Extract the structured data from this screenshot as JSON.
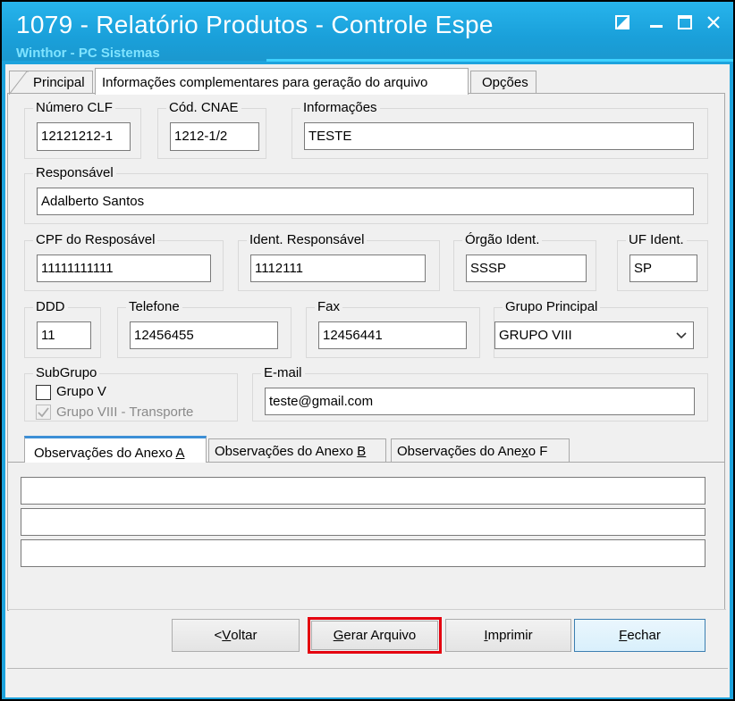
{
  "window": {
    "title": "1079 - Relatório Produtos - Controle Espe",
    "subtitle": "Winthor - PC Sistemas"
  },
  "tabs": [
    {
      "label": "Principal"
    },
    {
      "label": "Informações complementares para geração do arquivo"
    },
    {
      "label": "Opções"
    }
  ],
  "fields": {
    "numero_clf": {
      "label": "Número CLF",
      "value": "12121212-1"
    },
    "cod_cnae": {
      "label": "Cód. CNAE",
      "value": "1212-1/2"
    },
    "informacoes": {
      "label": "Informações",
      "value": "TESTE"
    },
    "responsavel": {
      "label": "Responsável",
      "value": "Adalberto Santos"
    },
    "cpf": {
      "label": "CPF do Resposável",
      "value": "11111111111"
    },
    "ident_responsavel": {
      "label": "Ident. Responsável",
      "value": "1112111"
    },
    "orgao_ident": {
      "label": "Órgão Ident.",
      "value": "SSSP"
    },
    "uf_ident": {
      "label": "UF Ident.",
      "value": "SP"
    },
    "ddd": {
      "label": "DDD",
      "value": "11"
    },
    "telefone": {
      "label": "Telefone",
      "value": "12456455"
    },
    "fax": {
      "label": "Fax",
      "value": "12456441"
    },
    "grupo_principal": {
      "label": "Grupo Principal",
      "value": "GRUPO VIII"
    },
    "email": {
      "label": "E-mail",
      "value": "teste@gmail.com"
    }
  },
  "subgrupo": {
    "label": "SubGrupo",
    "options": [
      {
        "label": "Grupo V",
        "checked": false,
        "enabled": true
      },
      {
        "label": "Grupo VIII - Transporte",
        "checked": true,
        "enabled": false
      }
    ]
  },
  "obs_tabs": {
    "a": {
      "prefix": "Observações do Anexo ",
      "key": "A"
    },
    "b": {
      "prefix": "Observações do Anexo ",
      "key": "B"
    },
    "f": {
      "prefix1": "Observações do Ane",
      "key": "x",
      "suffix": "o F"
    }
  },
  "buttons": {
    "voltar": {
      "prefix": "< ",
      "key": "V",
      "rest": "oltar"
    },
    "gerar": {
      "key": "G",
      "rest": "erar Arquivo"
    },
    "imprimir": {
      "key": "I",
      "rest": "mprimir"
    },
    "fechar": {
      "key": "F",
      "rest": "echar"
    }
  },
  "colors": {
    "titlebar": "#1da3dd",
    "highlight": "#e4000f",
    "active_tab_accent": "#3c8fd6"
  }
}
